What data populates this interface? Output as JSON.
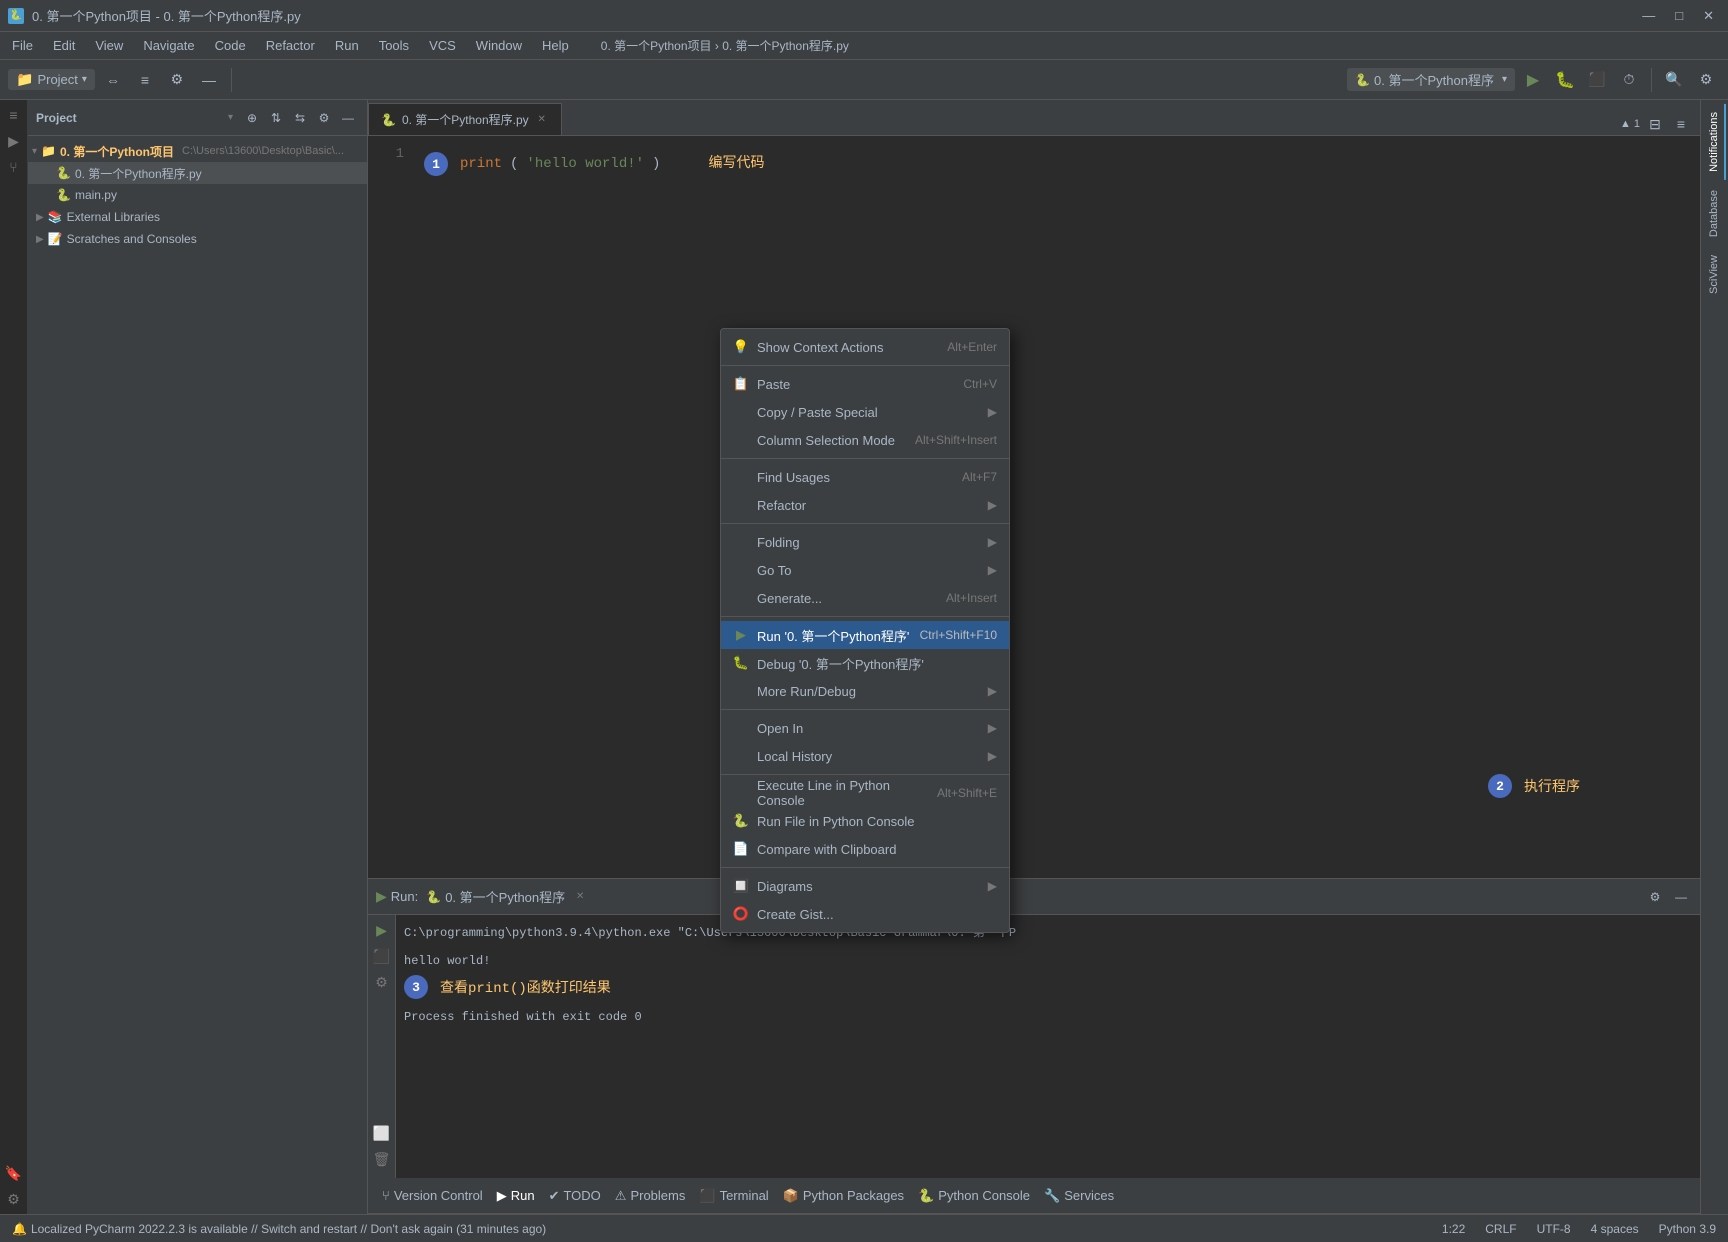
{
  "title_bar": {
    "icon": "🐍",
    "text": "0. 第一个Python项目 - 0. 第一个Python程序.py",
    "min_label": "—",
    "max_label": "□",
    "close_label": "✕"
  },
  "menu": {
    "items": [
      "File",
      "Edit",
      "View",
      "Navigate",
      "Code",
      "Refactor",
      "Run",
      "Tools",
      "VCS",
      "Window",
      "Help"
    ]
  },
  "toolbar": {
    "project_label": "0. 第一个Python项目",
    "breadcrumb": "0. 第一个Python程序.py",
    "run_label": "0. 第一个Python程序",
    "run_dropdown": "▾"
  },
  "tabs": {
    "active": "0. 第一个Python程序.py",
    "close_label": "✕"
  },
  "sidebar": {
    "title": "Project",
    "root": "0. 第一个Python项目",
    "root_path": "C:\\Users\\13600\\Desktop\\Basic...",
    "items": [
      {
        "label": "0. 第一个Python程序.py",
        "type": "py",
        "indent": 1
      },
      {
        "label": "main.py",
        "type": "py",
        "indent": 1
      },
      {
        "label": "External Libraries",
        "type": "folder",
        "indent": 0
      },
      {
        "label": "Scratches and Consoles",
        "type": "folder",
        "indent": 0
      }
    ]
  },
  "editor": {
    "line_number": "1",
    "code": "print('hello world!')",
    "annotation1_num": "1",
    "annotation1_label": "编写代码",
    "annotation2_num": "2",
    "annotation2_label": "执行程序",
    "annotation3_num": "3",
    "annotation3_label": "查看print()函数打印结果"
  },
  "context_menu": {
    "items": [
      {
        "label": "Show Context Actions",
        "shortcut": "Alt+Enter",
        "icon": "💡",
        "has_arrow": false
      },
      {
        "label": "Paste",
        "shortcut": "Ctrl+V",
        "icon": "📋",
        "has_arrow": false
      },
      {
        "label": "Copy / Paste Special",
        "shortcut": "",
        "icon": "",
        "has_arrow": true
      },
      {
        "label": "Column Selection Mode",
        "shortcut": "Alt+Shift+Insert",
        "icon": "",
        "has_arrow": false
      },
      {
        "label": "Find Usages",
        "shortcut": "Alt+F7",
        "icon": "",
        "has_arrow": false
      },
      {
        "label": "Refactor",
        "shortcut": "",
        "icon": "",
        "has_arrow": true
      },
      {
        "label": "Folding",
        "shortcut": "",
        "icon": "",
        "has_arrow": true
      },
      {
        "label": "Go To",
        "shortcut": "",
        "icon": "",
        "has_arrow": true
      },
      {
        "label": "Generate...",
        "shortcut": "Alt+Insert",
        "icon": "",
        "has_arrow": false
      },
      {
        "label": "Run '0. 第一个Python程序'",
        "shortcut": "Ctrl+Shift+F10",
        "icon": "▶",
        "has_arrow": false,
        "highlighted": true
      },
      {
        "label": "Debug '0. 第一个Python程序'",
        "shortcut": "",
        "icon": "🐛",
        "has_arrow": false
      },
      {
        "label": "More Run/Debug",
        "shortcut": "",
        "icon": "",
        "has_arrow": true
      },
      {
        "label": "Open In",
        "shortcut": "",
        "icon": "",
        "has_arrow": true
      },
      {
        "label": "Local History",
        "shortcut": "",
        "icon": "",
        "has_arrow": true
      },
      {
        "label": "Execute Line in Python Console",
        "shortcut": "Alt+Shift+E",
        "icon": "",
        "has_arrow": false
      },
      {
        "label": "Run File in Python Console",
        "shortcut": "",
        "icon": "🐍",
        "has_arrow": false
      },
      {
        "label": "Compare with Clipboard",
        "shortcut": "",
        "icon": "📄",
        "has_arrow": false
      },
      {
        "label": "Diagrams",
        "shortcut": "",
        "icon": "🔲",
        "has_arrow": true
      },
      {
        "label": "Create Gist...",
        "shortcut": "",
        "icon": "⭕",
        "has_arrow": false
      }
    ]
  },
  "run_panel": {
    "label": "Run:",
    "file_name": "0. 第一个Python程序",
    "close_label": "✕",
    "output_line1": "C:\\programming\\python3.9.4\\python.exe \"C:\\Users\\13600\\Desktop\\Basic Grammar\\0. 第一个P",
    "output_line2": "hello world!",
    "output_line3": "Process finished with exit code 0"
  },
  "bottom_tabs": [
    {
      "label": "Version Control",
      "icon": "⑂"
    },
    {
      "label": "Run",
      "icon": "▶",
      "active": true
    },
    {
      "label": "TODO",
      "icon": "✔"
    },
    {
      "label": "Problems",
      "icon": "⚠"
    },
    {
      "label": "Terminal",
      "icon": "⬛"
    },
    {
      "label": "Python Packages",
      "icon": "📦"
    },
    {
      "label": "Python Console",
      "icon": "🐍"
    },
    {
      "label": "Services",
      "icon": "🔧"
    }
  ],
  "status_bar": {
    "notification": "Localized PyCharm 2022.2.3 is available // Switch and restart // Don't ask again (31 minutes ago)",
    "position": "1:22",
    "line_sep": "CRLF",
    "encoding": "UTF-8",
    "indent": "4 spaces",
    "language": "Python 3.9"
  },
  "right_panels": [
    "Notifications",
    "Database",
    "SciView"
  ]
}
